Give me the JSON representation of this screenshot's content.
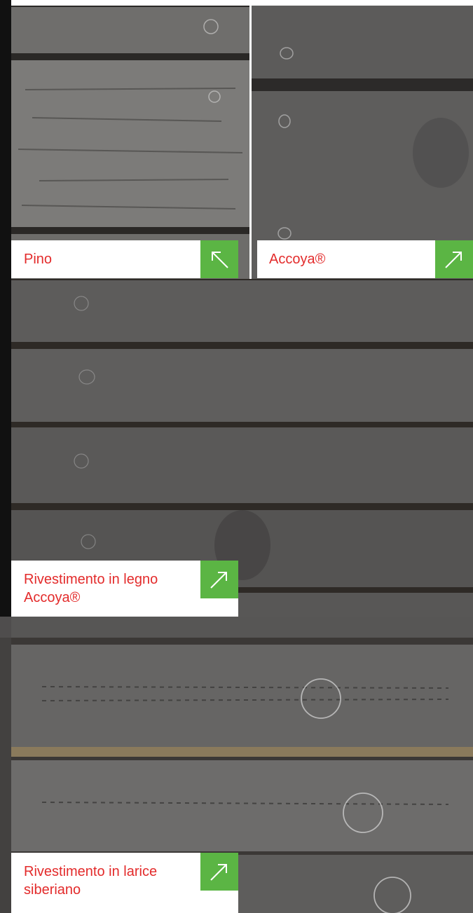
{
  "tiles": [
    {
      "label": "Pino",
      "arrow_icon": "arrow-up-left-icon"
    },
    {
      "label": "Accoya®",
      "arrow_icon": "arrow-up-right-icon"
    },
    {
      "label_line1": "Rivestimento in legno",
      "label_line2": "Accoya®",
      "arrow_icon": "arrow-up-right-icon"
    },
    {
      "label_line1": "Rivestimento in larice",
      "label_line2": "siberiano",
      "arrow_icon": "arrow-up-right-icon"
    }
  ],
  "colors": {
    "label_text": "#e32b2b",
    "arrow_button": "#5bb544",
    "arrow_stroke": "#ffffff"
  }
}
